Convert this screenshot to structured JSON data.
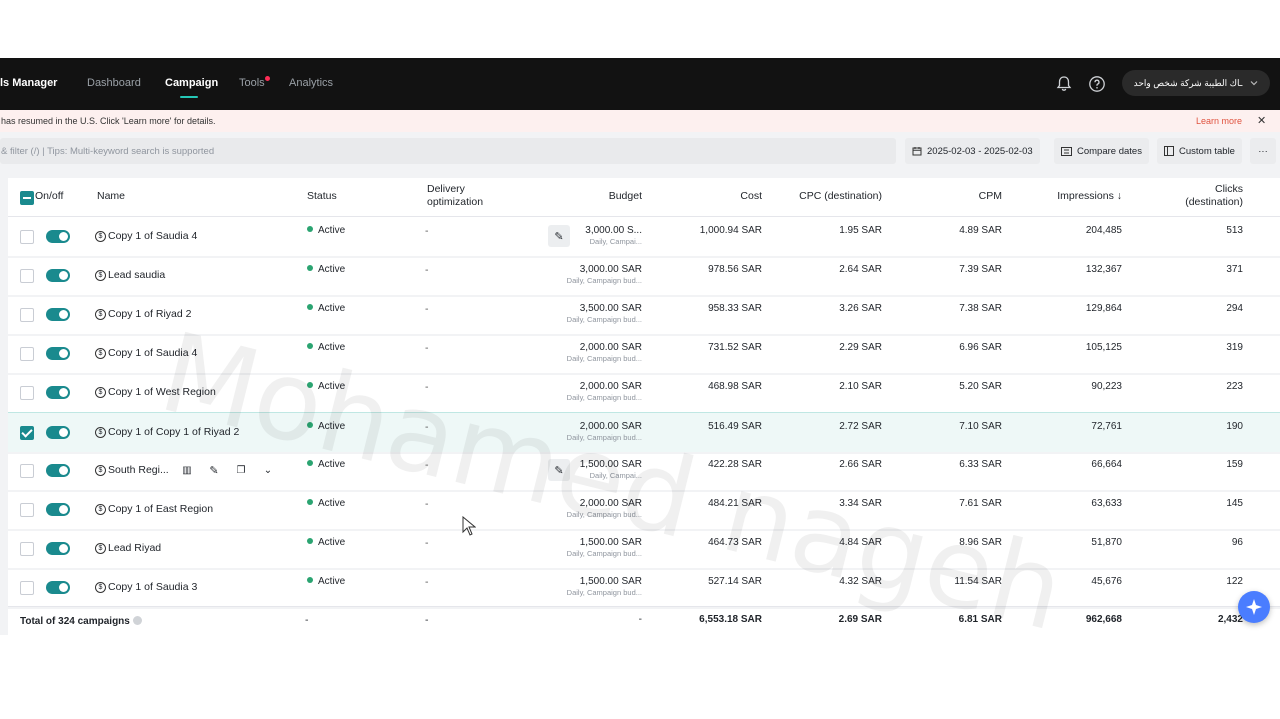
{
  "nav": {
    "brand": "ls Manager",
    "items": [
      {
        "label": "Dashboard",
        "active": false
      },
      {
        "label": "Campaign",
        "active": true
      },
      {
        "label": "Tools",
        "active": false,
        "badge": true
      },
      {
        "label": "Analytics",
        "active": false
      }
    ],
    "account": "ـاك الطيبة شركة شخص واحد"
  },
  "banner": {
    "text": "has resumed in the U.S. Click 'Learn more' for details.",
    "learn_more": "Learn more",
    "close": "✕"
  },
  "filter": {
    "placeholder": "& filter (/) | Tips: Multi-keyword search is supported",
    "date_range": "2025-02-03 - 2025-02-03",
    "compare": "Compare dates",
    "custom_table": "Custom table",
    "more": "···"
  },
  "table": {
    "headers": {
      "onoff": "On/off",
      "name": "Name",
      "status": "Status",
      "delivery_1": "Delivery",
      "delivery_2": "optimization",
      "budget": "Budget",
      "cost": "Cost",
      "cpc": "CPC (destination)",
      "cpm": "CPM",
      "impressions": "Impressions ↓",
      "clicks_1": "Clicks",
      "clicks_2": "(destination)"
    },
    "rows": [
      {
        "name": "Copy 1 of Saudia 4",
        "status": "Active",
        "delivery": "-",
        "budget": "3,000.00 S...",
        "budget_sub": "Daily, Campai...",
        "cost": "1,000.94 SAR",
        "cpc": "1.95 SAR",
        "cpm": "4.89 SAR",
        "impressions": "204,485",
        "clicks": "513"
      },
      {
        "name": "Lead saudia",
        "status": "Active",
        "delivery": "-",
        "budget": "3,000.00 SAR",
        "budget_sub": "Daily, Campaign bud...",
        "cost": "978.56 SAR",
        "cpc": "2.64 SAR",
        "cpm": "7.39 SAR",
        "impressions": "132,367",
        "clicks": "371"
      },
      {
        "name": "Copy 1 of Riyad 2",
        "status": "Active",
        "delivery": "-",
        "budget": "3,500.00 SAR",
        "budget_sub": "Daily, Campaign bud...",
        "cost": "958.33 SAR",
        "cpc": "3.26 SAR",
        "cpm": "7.38 SAR",
        "impressions": "129,864",
        "clicks": "294"
      },
      {
        "name": "Copy 1 of Saudia 4",
        "status": "Active",
        "delivery": "-",
        "budget": "2,000.00 SAR",
        "budget_sub": "Daily, Campaign bud...",
        "cost": "731.52 SAR",
        "cpc": "2.29 SAR",
        "cpm": "6.96 SAR",
        "impressions": "105,125",
        "clicks": "319"
      },
      {
        "name": "Copy 1 of West Region",
        "status": "Active",
        "delivery": "-",
        "budget": "2,000.00 SAR",
        "budget_sub": "Daily, Campaign bud...",
        "cost": "468.98 SAR",
        "cpc": "2.10 SAR",
        "cpm": "5.20 SAR",
        "impressions": "90,223",
        "clicks": "223"
      },
      {
        "name": "Copy 1 of Copy 1 of Riyad 2",
        "status": "Active",
        "delivery": "-",
        "budget": "2,000.00 SAR",
        "budget_sub": "Daily, Campaign bud...",
        "cost": "516.49 SAR",
        "cpc": "2.72 SAR",
        "cpm": "7.10 SAR",
        "impressions": "72,761",
        "clicks": "190"
      },
      {
        "name": "South Regi...",
        "status": "Active",
        "delivery": "-",
        "budget": "1,500.00 SAR",
        "budget_sub": "Daily, Campai...",
        "cost": "422.28 SAR",
        "cpc": "2.66 SAR",
        "cpm": "6.33 SAR",
        "impressions": "66,664",
        "clicks": "159"
      },
      {
        "name": "Copy 1 of East Region",
        "status": "Active",
        "delivery": "-",
        "budget": "2,000.00 SAR",
        "budget_sub": "Daily, Campaign bud...",
        "cost": "484.21 SAR",
        "cpc": "3.34 SAR",
        "cpm": "7.61 SAR",
        "impressions": "63,633",
        "clicks": "145"
      },
      {
        "name": "Lead Riyad",
        "status": "Active",
        "delivery": "-",
        "budget": "1,500.00 SAR",
        "budget_sub": "Daily, Campaign bud...",
        "cost": "464.73 SAR",
        "cpc": "4.84 SAR",
        "cpm": "8.96 SAR",
        "impressions": "51,870",
        "clicks": "96"
      },
      {
        "name": "Copy 1 of Saudia 3",
        "status": "Active",
        "delivery": "-",
        "budget": "1,500.00 SAR",
        "budget_sub": "Daily, Campaign bud...",
        "cost": "527.14 SAR",
        "cpc": "4.32 SAR",
        "cpm": "11.54 SAR",
        "impressions": "45,676",
        "clicks": "122"
      }
    ],
    "totals": {
      "label": "Total of 324 campaigns",
      "status": "-",
      "delivery": "-",
      "budget": "-",
      "cost": "6,553.18 SAR",
      "cpc": "2.69 SAR",
      "cpm": "6.81 SAR",
      "impressions": "962,668",
      "clicks": "2,432"
    }
  },
  "watermark": "Mohamed nageh",
  "colors": {
    "accent": "#1a8a8e",
    "active_dot": "#2ba471",
    "nav_bg": "#121212",
    "banner_link": "#e0533f"
  }
}
